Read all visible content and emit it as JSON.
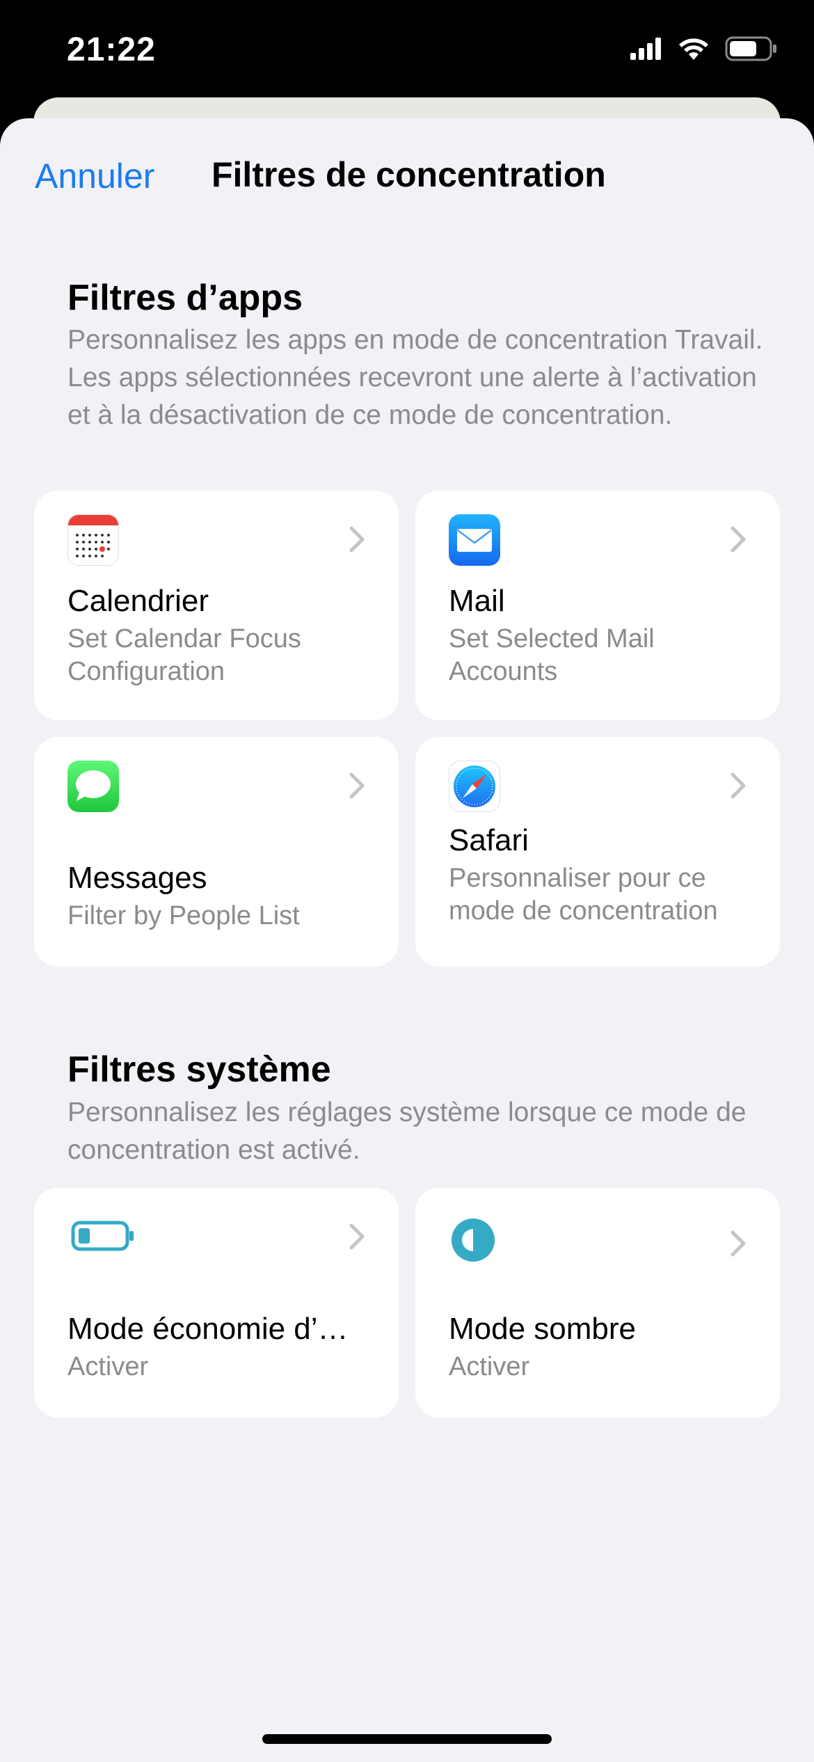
{
  "status_bar": {
    "time": "21:22"
  },
  "nav": {
    "cancel_label": "Annuler",
    "title": "Filtres de concentration"
  },
  "app_filters": {
    "title": "Filtres d’apps",
    "description": "Personnalisez les apps en mode de concentration Travail. Les apps sélectionnées recevront une alerte à l’activation et à la désactivation de ce mode de concentration.",
    "cards": [
      {
        "title": "Calendrier",
        "subtitle": "Set Calendar Focus Configuration",
        "icon": "calendar-icon"
      },
      {
        "title": "Mail",
        "subtitle": "Set Selected Mail Accounts",
        "icon": "mail-icon"
      },
      {
        "title": "Messages",
        "subtitle": "Filter by People List",
        "icon": "messages-icon"
      },
      {
        "title": "Safari",
        "subtitle": "Personnaliser pour ce mode de concentration",
        "icon": "safari-icon"
      }
    ]
  },
  "system_filters": {
    "title": "Filtres système",
    "description": "Personnalisez les réglages système lorsque ce mode de concentration est activé.",
    "cards": [
      {
        "title": "Mode économie d’…",
        "subtitle": "Activer",
        "icon": "low-power-battery-icon"
      },
      {
        "title": "Mode sombre",
        "subtitle": "Activer",
        "icon": "dark-mode-icon"
      }
    ]
  },
  "colors": {
    "accent": "#1a7cf0",
    "sheet_background": "#f2f1f6",
    "secondary_text": "#8a8a8f",
    "system_icon_teal": "#34aac4"
  }
}
